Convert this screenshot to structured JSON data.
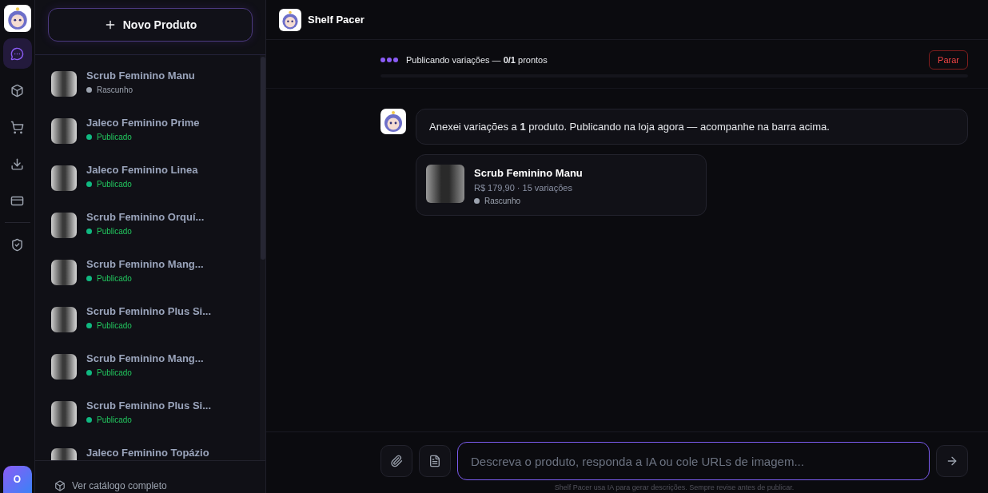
{
  "rail": {
    "items": [
      {
        "selected": true
      },
      {
        "selected": false
      },
      {
        "selected": false
      },
      {
        "selected": false
      },
      {
        "selected": false
      },
      {
        "selected": false
      }
    ],
    "user_initial": "O"
  },
  "sidebar": {
    "new_button": "Novo Produto",
    "products": [
      {
        "name": "Scrub Feminino Manu",
        "status": "Rascunho",
        "kind": "draft"
      },
      {
        "name": "Jaleco Feminino Prime",
        "status": "Publicado",
        "kind": "published"
      },
      {
        "name": "Jaleco Feminino Linea",
        "status": "Publicado",
        "kind": "published"
      },
      {
        "name": "Scrub Feminino Orquí...",
        "status": "Publicado",
        "kind": "published"
      },
      {
        "name": "Scrub Feminino Mang...",
        "status": "Publicado",
        "kind": "published"
      },
      {
        "name": "Scrub Feminino Plus Si...",
        "status": "Publicado",
        "kind": "published"
      },
      {
        "name": "Scrub Feminino Mang...",
        "status": "Publicado",
        "kind": "published"
      },
      {
        "name": "Scrub Feminino Plus Si...",
        "status": "Publicado",
        "kind": "published"
      },
      {
        "name": "Jaleco Feminino Topázio"
      }
    ],
    "footer_link": "Ver catálogo completo"
  },
  "header": {
    "title": "Shelf Pacer"
  },
  "progress": {
    "text": "Publicando variações — **0/1** prontos",
    "stop_button": "Parar"
  },
  "messages": [
    {
      "text": "Anexei variações a **1** produto. Publicando na loja agora — acompanhe na barra acima.",
      "product": {
        "name": "Scrub Feminino Manu",
        "details": "R$ 179,90 · 15 variações",
        "status": "Rascunho",
        "kind": "draft"
      }
    }
  ],
  "composer": {
    "placeholder": "Descreva o produto, responda a IA ou cole URLs de imagem...",
    "note": "Shelf Pacer usa IA para gerar descrições. Sempre revise antes de publicar."
  }
}
